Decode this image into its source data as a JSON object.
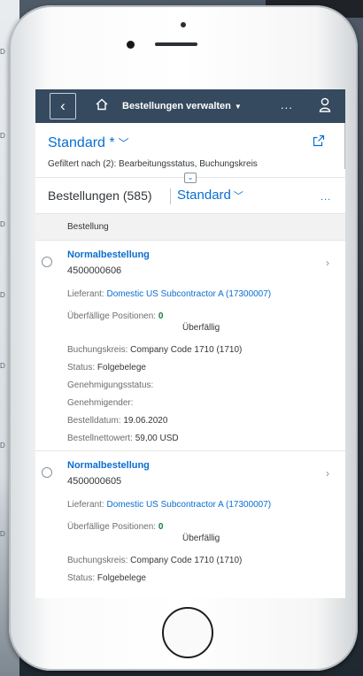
{
  "shell": {
    "back_glyph": "‹",
    "app_title": "Bestellungen verwalten",
    "more": "..."
  },
  "header": {
    "variant": "Standard *",
    "filtered_text": "Gefiltert nach (2): Bearbeitungsstatus, Buchungskreis"
  },
  "toolbar": {
    "title": "Bestellungen (585)",
    "variant": "Standard",
    "more": "..."
  },
  "columns": {
    "bestellung": "Bestellung"
  },
  "items": [
    {
      "title": "Normalbestellung",
      "number": "4500000606",
      "supplier_label": "Lieferant:",
      "supplier": "Domestic US Subcontractor A (17300007)",
      "overdue_label": "Überfällige Positionen:",
      "overdue_value": "0",
      "overdue_sub": "Überfällig",
      "company_label": "Buchungskreis:",
      "company": "Company Code 1710 (1710)",
      "status_label": "Status:",
      "status": "Folgebelege",
      "approval_label": "Genehmigungsstatus:",
      "approver_label": "Genehmigender:",
      "date_label": "Bestelldatum:",
      "date": "19.06.2020",
      "net_label": "Bestellnettowert:",
      "net": "59,00",
      "currency": "USD"
    },
    {
      "title": "Normalbestellung",
      "number": "4500000605",
      "supplier_label": "Lieferant:",
      "supplier": "Domestic US Subcontractor A (17300007)",
      "overdue_label": "Überfällige Positionen:",
      "overdue_value": "0",
      "overdue_sub": "Überfällig",
      "company_label": "Buchungskreis:",
      "company": "Company Code 1710 (1710)",
      "status_label": "Status:",
      "status": "Folgebelege"
    }
  ],
  "icons": {
    "home": "home-icon",
    "user": "user-icon",
    "share": "share-icon",
    "chevron": "chevron-down-icon",
    "nav": "chevron-right-icon"
  },
  "colors": {
    "shellbar": "#354a5f",
    "link": "#0a6ed1",
    "positive": "#107e3e"
  }
}
